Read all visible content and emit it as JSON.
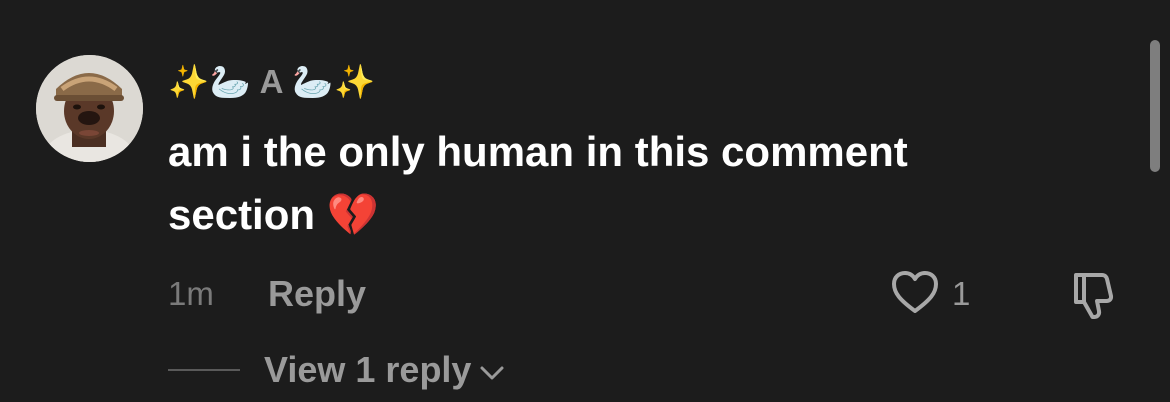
{
  "comment": {
    "username": "✨🦢 A 🦢✨",
    "text": "am i the only human in this comment section 💔",
    "timestamp": "1m",
    "reply_label": "Reply",
    "like_count": "1",
    "view_replies_label": "View 1 reply"
  },
  "icons": {
    "like": "heart-outline-icon",
    "dislike": "thumbs-down-icon",
    "expand": "chevron-down-icon"
  },
  "colors": {
    "background": "#1c1c1c",
    "primary_text": "#ffffff",
    "secondary_text": "#9a9a9a",
    "muted_text": "#7a7a7a"
  }
}
